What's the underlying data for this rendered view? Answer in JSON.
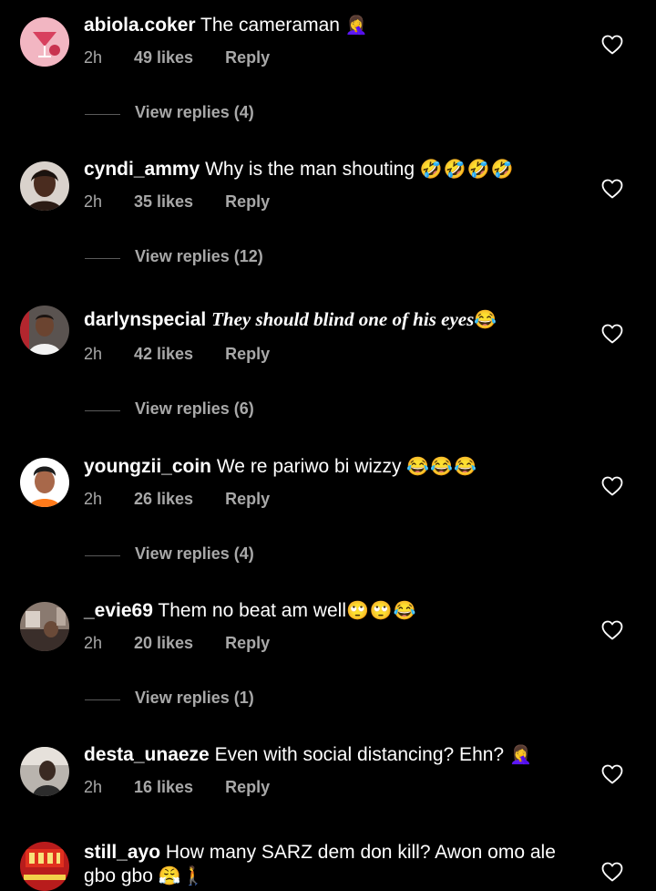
{
  "comments": [
    {
      "username": "abiola.coker",
      "text": "The cameraman",
      "emoji": "🤦‍♀️",
      "time": "2h",
      "likes": "49 likes",
      "reply": "Reply",
      "view_replies": "View replies (4)"
    },
    {
      "username": "cyndi_ammy",
      "text": "Why is the man shouting",
      "emoji": "🤣🤣🤣🤣",
      "time": "2h",
      "likes": "35 likes",
      "reply": "Reply",
      "view_replies": "View replies (12)"
    },
    {
      "username": "darlynspecial",
      "text": "They should blind one of his eyes",
      "emoji": "😂",
      "time": "2h",
      "likes": "42 likes",
      "reply": "Reply",
      "view_replies": "View replies (6)"
    },
    {
      "username": "youngzii_coin",
      "text": "We re pariwo bi wizzy",
      "emoji": "😂😂😂",
      "time": "2h",
      "likes": "26 likes",
      "reply": "Reply",
      "view_replies": "View replies (4)"
    },
    {
      "username": "_evie69",
      "text": "Them no beat am well",
      "emoji": "🙄🙄😂",
      "time": "2h",
      "likes": "20 likes",
      "reply": "Reply",
      "view_replies": "View replies (1)"
    },
    {
      "username": "desta_unaeze",
      "text": "Even with social distancing? Ehn?",
      "emoji": "🤦‍♀️",
      "time": "2h",
      "likes": "16 likes",
      "reply": "Reply"
    },
    {
      "username": "still_ayo",
      "text": "How many SARZ dem don kill? Awon omo ale gbo gbo",
      "emoji": "😤🚶"
    }
  ],
  "icons": {
    "like": "heart-outline-icon"
  },
  "colors": {
    "background": "#000000",
    "primary_text": "#ffffff",
    "secondary_text": "#a8a8a8"
  }
}
